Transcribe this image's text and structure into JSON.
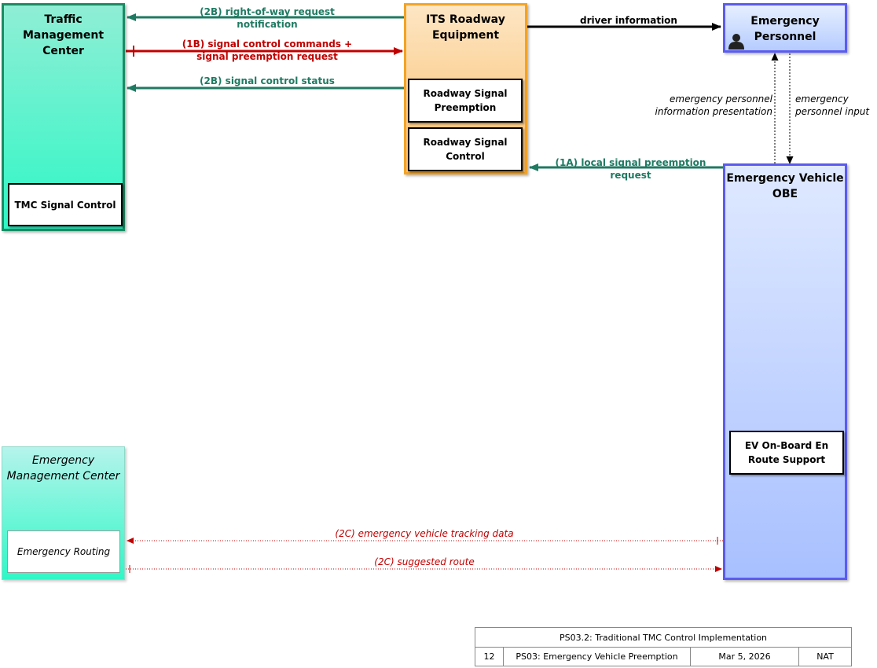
{
  "nodes": {
    "tmc": {
      "title": "Traffic Management\nCenter",
      "sub": "TMC Signal Control"
    },
    "emc": {
      "title": "Emergency\nManagement Center",
      "sub": "Emergency Routing"
    },
    "rse": {
      "title": "ITS Roadway\nEquipment",
      "sub1": "Roadway Signal\nPreemption",
      "sub2": "Roadway Signal\nControl"
    },
    "ep": {
      "title": "Emergency\nPersonnel"
    },
    "ev": {
      "title": "Emergency Vehicle\nOBE",
      "sub": "EV On-Board En\nRoute Support"
    }
  },
  "flows": {
    "row_notification": "(2B) right-of-way request\nnotification",
    "signal_commands": "(1B) signal control commands +\nsignal preemption request",
    "signal_status": "(2B) signal control status",
    "driver_info": "driver information",
    "ep_presentation": "emergency personnel\ninformation presentation",
    "ep_input": "emergency\npersonnel input",
    "local_preemption": "(1A) local signal preemption request",
    "tracking": "(2C) emergency vehicle tracking data",
    "suggested_route": "(2C) suggested route"
  },
  "legend": {
    "title": "PS03.2: Traditional TMC Control Implementation",
    "page": "12",
    "package": "PS03: Emergency Vehicle Preemption",
    "date": "Mar 5, 2026",
    "scope": "NAT"
  },
  "colors": {
    "green": "#1f7a62",
    "red": "#c00000",
    "black": "#000000"
  }
}
